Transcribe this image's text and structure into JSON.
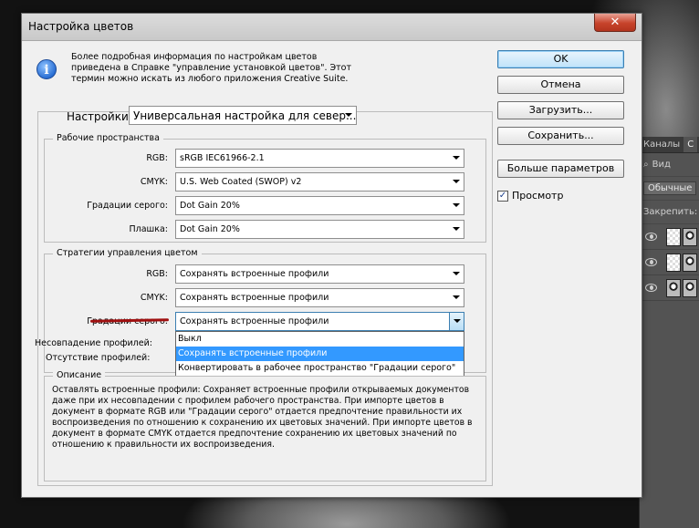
{
  "dialog": {
    "title": "Настройка цветов",
    "close_glyph": "✕",
    "info_icon_glyph": "i",
    "info_lines": [
      "Более подробная информация по настройкам цветов",
      "приведена в Справке \"управление установкой цветов\". Этот",
      "термин можно искать из любого приложения Creative Suite."
    ]
  },
  "buttons": {
    "ok": "OK",
    "cancel": "Отмена",
    "load": "Загрузить...",
    "save": "Сохранить...",
    "more": "Больше параметров"
  },
  "preview": {
    "label": "Просмотр",
    "checked": true,
    "check_glyph": "✓"
  },
  "settings": {
    "label": "Настройки:",
    "value": "Универсальная настройка для север..."
  },
  "workspaces": {
    "title": "Рабочие пространства",
    "rows": [
      {
        "label": "RGB:",
        "value": "sRGB IEC61966-2.1"
      },
      {
        "label": "CMYK:",
        "value": "U.S. Web Coated (SWOP) v2"
      },
      {
        "label": "Градации серого:",
        "value": "Dot Gain 20%"
      },
      {
        "label": "Плашка:",
        "value": "Dot Gain 20%"
      }
    ]
  },
  "strategies": {
    "title": "Стратегии управления цветом",
    "rows": [
      {
        "label": "RGB:",
        "value": "Сохранять встроенные профили"
      },
      {
        "label": "CMYK:",
        "value": "Сохранять встроенные профили"
      },
      {
        "label": "Градации серого:",
        "value": "Сохранять встроенные профили"
      }
    ],
    "mismatch_label": "Несовпадение профилей:",
    "missing_label": "Отсутствие профилей:",
    "dropdown_options": [
      "Выкл",
      "Сохранять встроенные профили",
      "Конвертировать в рабочее пространство \"Градации серого\""
    ],
    "dropdown_selected_index": 1
  },
  "description": {
    "title": "Описание",
    "lines": [
      "Оставлять встроенные профили:  Сохраняет встроенные профили открываемых документов",
      "даже при их несовпадении с профилем рабочего пространства. При импорте цветов в",
      "документ в формате RGB или \"Градации серого\" отдается предпочтение правильности их",
      "воспроизведения по отношению к сохранению их цветовых значений. При импорте цветов в",
      "документ в формате CMYK отдается предпочтение сохранению их цветовых значений по",
      "отношению к правильности их воспроизведения."
    ]
  },
  "ps_panel": {
    "tab_channels": "Каналы",
    "tab_layers": "С",
    "view_label": "Вид",
    "blend_mode": "Обычные",
    "lock_label": "Закрепить:"
  },
  "colors": {
    "selection": "#3399ff",
    "annotation_underline": "#a01010",
    "close_button": "#c7432b"
  }
}
